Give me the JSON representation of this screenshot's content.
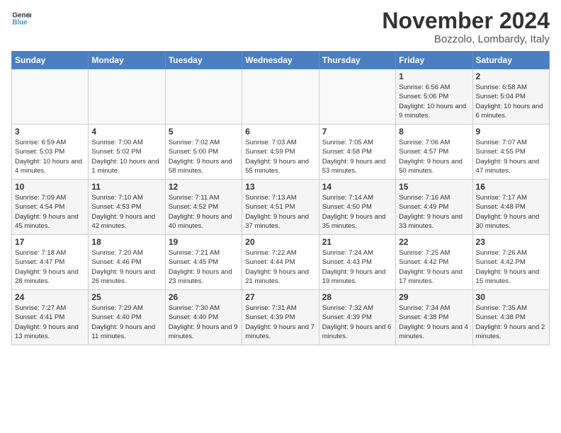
{
  "logo": {
    "line1": "General",
    "line2": "Blue"
  },
  "title": "November 2024",
  "location": "Bozzolo, Lombardy, Italy",
  "days_of_week": [
    "Sunday",
    "Monday",
    "Tuesday",
    "Wednesday",
    "Thursday",
    "Friday",
    "Saturday"
  ],
  "weeks": [
    [
      {
        "day": "",
        "info": ""
      },
      {
        "day": "",
        "info": ""
      },
      {
        "day": "",
        "info": ""
      },
      {
        "day": "",
        "info": ""
      },
      {
        "day": "",
        "info": ""
      },
      {
        "day": "1",
        "info": "Sunrise: 6:56 AM\nSunset: 5:06 PM\nDaylight: 10 hours and 9 minutes."
      },
      {
        "day": "2",
        "info": "Sunrise: 6:58 AM\nSunset: 5:04 PM\nDaylight: 10 hours and 6 minutes."
      }
    ],
    [
      {
        "day": "3",
        "info": "Sunrise: 6:59 AM\nSunset: 5:03 PM\nDaylight: 10 hours and 4 minutes."
      },
      {
        "day": "4",
        "info": "Sunrise: 7:00 AM\nSunset: 5:02 PM\nDaylight: 10 hours and 1 minute."
      },
      {
        "day": "5",
        "info": "Sunrise: 7:02 AM\nSunset: 5:00 PM\nDaylight: 9 hours and 58 minutes."
      },
      {
        "day": "6",
        "info": "Sunrise: 7:03 AM\nSunset: 4:59 PM\nDaylight: 9 hours and 55 minutes."
      },
      {
        "day": "7",
        "info": "Sunrise: 7:05 AM\nSunset: 4:58 PM\nDaylight: 9 hours and 53 minutes."
      },
      {
        "day": "8",
        "info": "Sunrise: 7:06 AM\nSunset: 4:57 PM\nDaylight: 9 hours and 50 minutes."
      },
      {
        "day": "9",
        "info": "Sunrise: 7:07 AM\nSunset: 4:55 PM\nDaylight: 9 hours and 47 minutes."
      }
    ],
    [
      {
        "day": "10",
        "info": "Sunrise: 7:09 AM\nSunset: 4:54 PM\nDaylight: 9 hours and 45 minutes."
      },
      {
        "day": "11",
        "info": "Sunrise: 7:10 AM\nSunset: 4:53 PM\nDaylight: 9 hours and 42 minutes."
      },
      {
        "day": "12",
        "info": "Sunrise: 7:11 AM\nSunset: 4:52 PM\nDaylight: 9 hours and 40 minutes."
      },
      {
        "day": "13",
        "info": "Sunrise: 7:13 AM\nSunset: 4:51 PM\nDaylight: 9 hours and 37 minutes."
      },
      {
        "day": "14",
        "info": "Sunrise: 7:14 AM\nSunset: 4:50 PM\nDaylight: 9 hours and 35 minutes."
      },
      {
        "day": "15",
        "info": "Sunrise: 7:16 AM\nSunset: 4:49 PM\nDaylight: 9 hours and 33 minutes."
      },
      {
        "day": "16",
        "info": "Sunrise: 7:17 AM\nSunset: 4:48 PM\nDaylight: 9 hours and 30 minutes."
      }
    ],
    [
      {
        "day": "17",
        "info": "Sunrise: 7:18 AM\nSunset: 4:47 PM\nDaylight: 9 hours and 28 minutes."
      },
      {
        "day": "18",
        "info": "Sunrise: 7:20 AM\nSunset: 4:46 PM\nDaylight: 9 hours and 26 minutes."
      },
      {
        "day": "19",
        "info": "Sunrise: 7:21 AM\nSunset: 4:45 PM\nDaylight: 9 hours and 23 minutes."
      },
      {
        "day": "20",
        "info": "Sunrise: 7:22 AM\nSunset: 4:44 PM\nDaylight: 9 hours and 21 minutes."
      },
      {
        "day": "21",
        "info": "Sunrise: 7:24 AM\nSunset: 4:43 PM\nDaylight: 9 hours and 19 minutes."
      },
      {
        "day": "22",
        "info": "Sunrise: 7:25 AM\nSunset: 4:42 PM\nDaylight: 9 hours and 17 minutes."
      },
      {
        "day": "23",
        "info": "Sunrise: 7:26 AM\nSunset: 4:42 PM\nDaylight: 9 hours and 15 minutes."
      }
    ],
    [
      {
        "day": "24",
        "info": "Sunrise: 7:27 AM\nSunset: 4:41 PM\nDaylight: 9 hours and 13 minutes."
      },
      {
        "day": "25",
        "info": "Sunrise: 7:29 AM\nSunset: 4:40 PM\nDaylight: 9 hours and 11 minutes."
      },
      {
        "day": "26",
        "info": "Sunrise: 7:30 AM\nSunset: 4:40 PM\nDaylight: 9 hours and 9 minutes."
      },
      {
        "day": "27",
        "info": "Sunrise: 7:31 AM\nSunset: 4:39 PM\nDaylight: 9 hours and 7 minutes."
      },
      {
        "day": "28",
        "info": "Sunrise: 7:32 AM\nSunset: 4:39 PM\nDaylight: 9 hours and 6 minutes."
      },
      {
        "day": "29",
        "info": "Sunrise: 7:34 AM\nSunset: 4:38 PM\nDaylight: 9 hours and 4 minutes."
      },
      {
        "day": "30",
        "info": "Sunrise: 7:35 AM\nSunset: 4:38 PM\nDaylight: 9 hours and 2 minutes."
      }
    ]
  ]
}
